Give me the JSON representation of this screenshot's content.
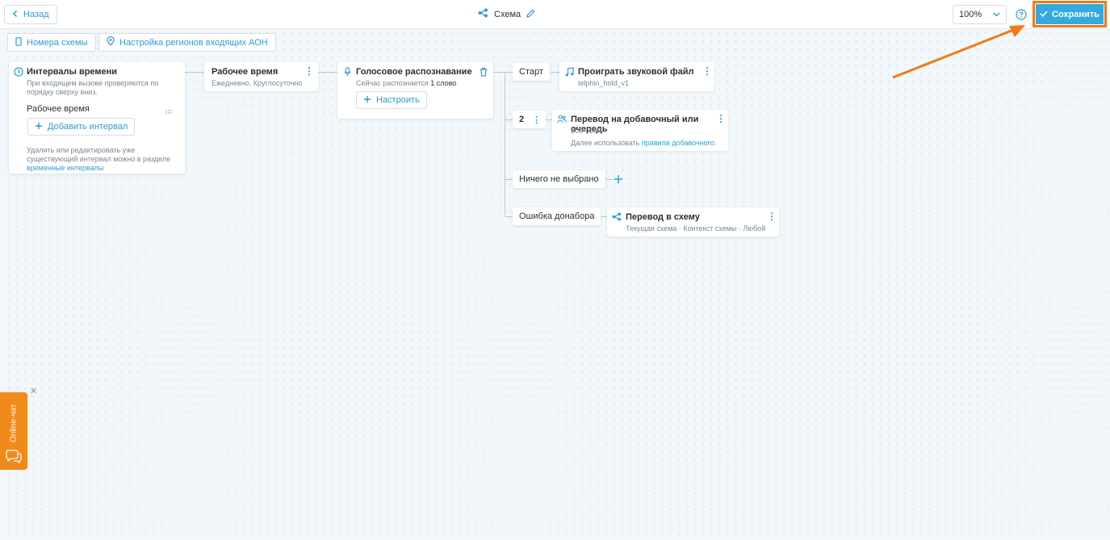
{
  "colors": {
    "accent": "#2f9bd6",
    "save_bg": "#33a9e0",
    "highlight": "#f07a17",
    "chat_tab": "#f08a1a"
  },
  "header": {
    "back_label": "Назад",
    "title": "Схема",
    "zoom": "100%",
    "save_label": "Сохранить"
  },
  "toolbar": {
    "numbers_label": "Номера схемы",
    "regions_label": "Настройка регионов входящих АОН"
  },
  "intervals": {
    "title": "Интервалы времени",
    "description": "При входящем вызове проверяются по порядку сверху вниз.",
    "item": "Рабочее время",
    "add_label": "Добавить интервал",
    "footer_text": "Удалить или редактировать уже существующий интервал можно в разделе",
    "footer_link": "временные интервалы"
  },
  "worktime": {
    "title": "Рабочее время",
    "subtitle": "Ежедневно. Круглосуточно"
  },
  "voice": {
    "title": "Голосовое распознавание",
    "subtitle_prefix": "Сейчас распознается",
    "subtitle_value": "1 слово",
    "configure_label": "Настроить"
  },
  "branches": [
    {
      "label": "Старт",
      "action_title": "Проиграть звуковой файл",
      "action_sub": "telphin_hold_v1"
    },
    {
      "label": "2",
      "action_title": "Перевод на добавочный или очередь",
      "action_sub": "200 · 200.",
      "action_note_prefix": "Далее использовать",
      "action_note_link": "правила добавочного."
    },
    {
      "label": "Ничего не выбрано"
    },
    {
      "label": "Ошибка донабора",
      "action_title": "Перевод в схему",
      "action_sub": "Текущая схема · Контекст схемы · Любой"
    }
  ],
  "chat": {
    "label": "Online-чат"
  }
}
